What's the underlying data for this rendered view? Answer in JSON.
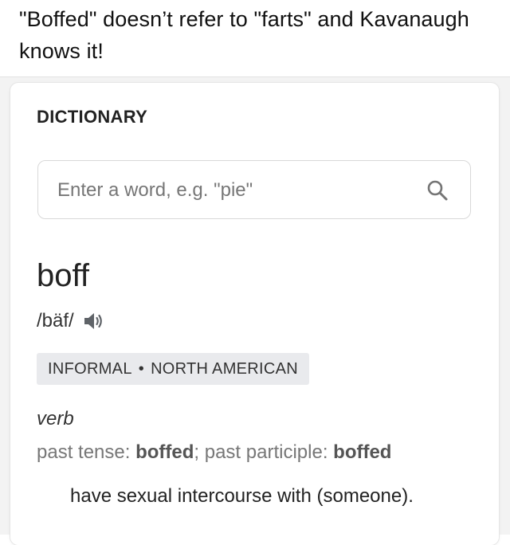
{
  "post": {
    "text": "\"Boffed\" doesn’t refer to \"farts\" and Kavanaugh knows it!"
  },
  "dictionary": {
    "heading": "DICTIONARY",
    "search": {
      "placeholder": "Enter a word, e.g. \"pie\"",
      "value": "",
      "icon": "search-icon"
    },
    "entry": {
      "word": "boff",
      "pronunciation": "/bäf/",
      "audio_icon": "speaker-icon",
      "labels": [
        "INFORMAL",
        "NORTH AMERICAN"
      ],
      "separator": "•",
      "part_of_speech": "verb",
      "inflections": {
        "past_tense_label": "past tense: ",
        "past_tense": "boffed",
        "separator": "; ",
        "past_participle_label": "past participle: ",
        "past_participle": "boffed"
      },
      "definition": "have sexual intercourse with (someone)."
    }
  },
  "colors": {
    "background": "#ffffff",
    "page_background": "#f3f3f3",
    "badge_background": "#e9eaed",
    "muted_text": "#777777",
    "icon_gray": "#757575"
  }
}
